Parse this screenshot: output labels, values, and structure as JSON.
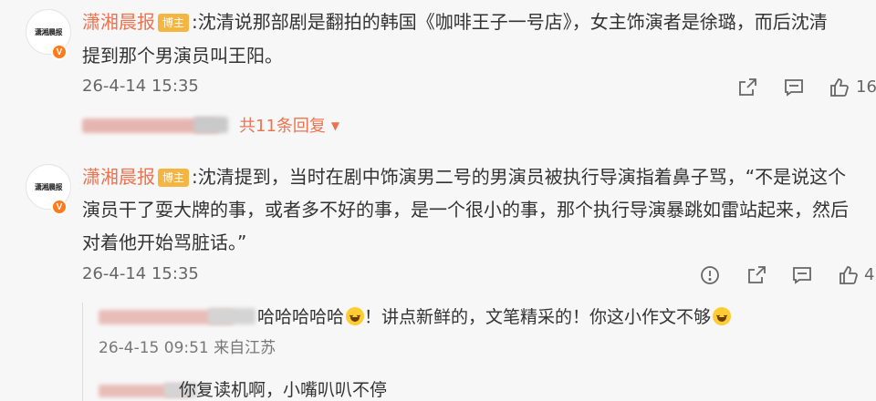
{
  "comment1": {
    "avatar_text": "潇湘晨报",
    "author": "潇湘晨报",
    "badge": "博主",
    "text_prefix": ":",
    "lines": [
      "沈清说那部剧是翻拍的韩国《咖啡王子一号店》，女主饰演者是徐璐，而后沈清",
      "提到那个男演员叫王阳。"
    ],
    "time": "26-4-14 15:35",
    "like_count": "16",
    "replies_label": "共11条回复"
  },
  "comment2": {
    "avatar_text": "潇湘晨报",
    "author": "潇湘晨报",
    "badge": "博主",
    "text_prefix": ":",
    "lines": [
      "沈清提到，当时在剧中饰演男二号的男演员被执行导演指着鼻子骂，“不是说这个",
      "演员干了耍大牌的事，或者多不好的事，是一个很小的事，那个执行导演暴跳如雷站起来，然后",
      "对着他开始骂脏话。”"
    ],
    "time": "26-4-14 15:35",
    "like_count": "4"
  },
  "sub_comments": [
    {
      "text_a": "哈哈哈哈哈",
      "text_b": "！讲点新鲜的，文笔精采的！你这小作文不够",
      "meta": "26-4-15 09:51 来自江苏"
    },
    {
      "text_a": "你复读机啊，小嘴叭叭不停"
    }
  ],
  "icons": {
    "share": "share-icon",
    "comment": "comment-icon",
    "like": "like-icon",
    "report": "report-icon",
    "verified": "verified-v-icon"
  },
  "colors": {
    "author": "#eb7350",
    "badge": "#f5b541",
    "verified": "#ff7a1a",
    "background": "#f7f7f7"
  }
}
